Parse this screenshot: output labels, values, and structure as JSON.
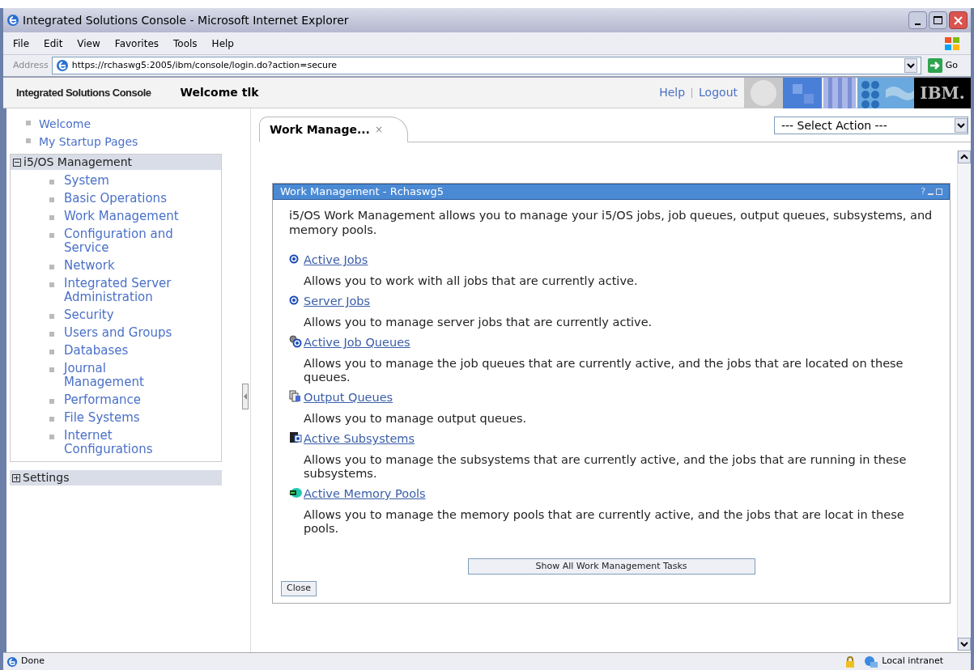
{
  "window": {
    "title": "Integrated Solutions Console - Microsoft Internet Explorer"
  },
  "menu": [
    "File",
    "Edit",
    "View",
    "Favorites",
    "Tools",
    "Help"
  ],
  "address": {
    "label": "Address",
    "url": "https://rchaswg5:2005/ibm/console/login.do?action=secure",
    "go": "Go"
  },
  "header": {
    "product": "Integrated Solutions Console",
    "welcome": "Welcome tlk",
    "links": [
      "Help",
      "Logout"
    ],
    "logo": "IBM."
  },
  "sidebar": {
    "top_links": [
      "Welcome",
      "My Startup Pages"
    ],
    "sections": [
      {
        "label": "i5/OS Management",
        "expanded": true,
        "items": [
          "System",
          "Basic Operations",
          "Work Management",
          "Configuration and Service",
          "Network",
          "Integrated Server Administration",
          "Security",
          "Users and Groups",
          "Databases",
          "Journal Management",
          "Performance",
          "File Systems",
          "Internet Configurations"
        ]
      },
      {
        "label": "Settings",
        "expanded": false
      }
    ]
  },
  "tabs": [
    {
      "label": "Work Manage...",
      "close": "×",
      "selected": true
    }
  ],
  "select_action": "--- Select Action ---",
  "portlet": {
    "title": "Work Management - Rchaswg5",
    "controls": "?",
    "intro": "i5/OS Work Management allows you to manage your i5/OS jobs, job queues, output queues, subsystems, and memory pools.",
    "tasks": [
      {
        "kind": "job",
        "link": "Active Jobs",
        "description": "Allows you to work with all jobs that are currently active."
      },
      {
        "kind": "job",
        "link": "Server Jobs",
        "description": "Allows you to manage server jobs that are currently active."
      },
      {
        "kind": "jobqueue",
        "link": "Active Job Queues",
        "description": "Allows you to manage the job queues that are currently active, and the jobs that are located on these queues."
      },
      {
        "kind": "outqueue",
        "link": "Output Queues",
        "description": "Allows you to manage output queues."
      },
      {
        "kind": "subsystem",
        "link": "Active Subsystems",
        "description": "Allows you to manage the subsystems that are currently active, and the jobs that are running in these subsystems."
      },
      {
        "kind": "memory",
        "link": "Active Memory Pools",
        "description": "Allows you to manage the memory pools that are currently active, and the jobs that are locat in these pools."
      }
    ],
    "show_all": "Show All Work Management Tasks",
    "close": "Close"
  },
  "status_bar": {
    "text": "Done",
    "zone": "Local intranet"
  }
}
